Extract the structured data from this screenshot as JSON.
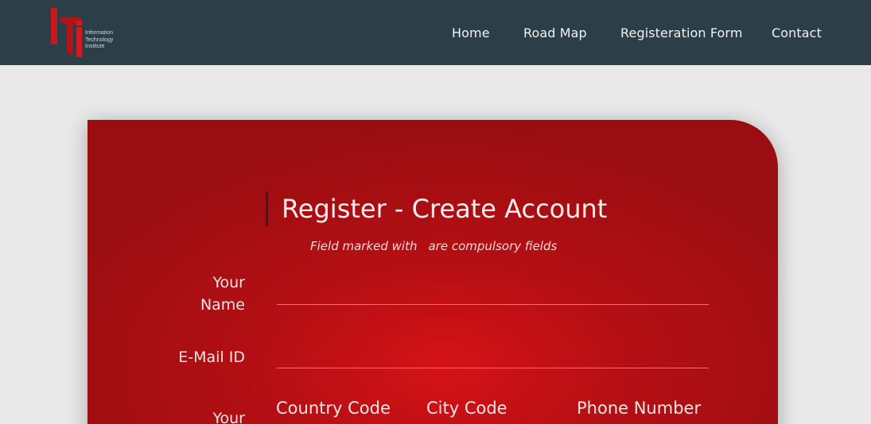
{
  "header": {
    "logo_text": [
      "Information",
      "Technology",
      "Institute"
    ],
    "nav": {
      "home": "Home",
      "road_map": "Road Map",
      "registration": "Registeration Form",
      "contact": "Contact"
    }
  },
  "form": {
    "title": "Register - Create Account",
    "note_before": "Field marked with",
    "note_after": "are compulsory fields",
    "name_label_line1": "Your",
    "name_label_line2": "Name",
    "email_label": "E-Mail ID",
    "phone_label_line1": "Your",
    "name_value": "",
    "email_value": "",
    "country_code_placeholder": "Country Code",
    "city_code_placeholder": "City Code",
    "phone_number_placeholder": "Phone Number",
    "required_marker": "*"
  },
  "colors": {
    "header_bg": "#2c3e48",
    "card_red": "#c40f14",
    "page_bg": "#e9e9e9"
  }
}
